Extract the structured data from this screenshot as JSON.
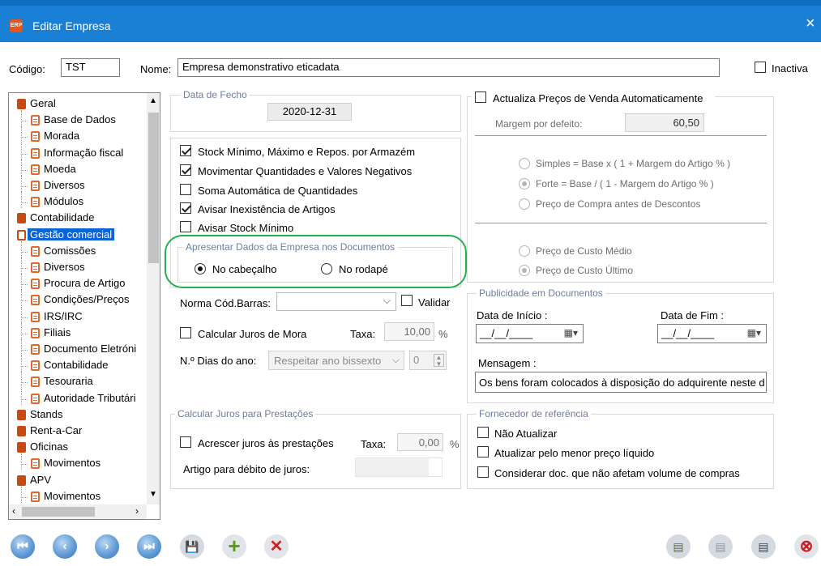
{
  "window": {
    "title": "Editar Empresa",
    "app_icon_text": "ERP",
    "close": "×"
  },
  "header": {
    "codigo_label": "Código:",
    "codigo_value": "TST",
    "nome_label": "Nome:",
    "nome_value": "Empresa demonstrativo eticadata",
    "inactiva_label": "Inactiva"
  },
  "tree": [
    {
      "label": "Geral",
      "level": 0
    },
    {
      "label": "Base de Dados",
      "level": 1
    },
    {
      "label": "Morada",
      "level": 1
    },
    {
      "label": "Informação fiscal",
      "level": 1
    },
    {
      "label": "Moeda",
      "level": 1
    },
    {
      "label": "Diversos",
      "level": 1
    },
    {
      "label": "Módulos",
      "level": 1
    },
    {
      "label": "Contabilidade",
      "level": 0
    },
    {
      "label": "Gestão comercial",
      "level": 0,
      "selected": true
    },
    {
      "label": "Comissões",
      "level": 1
    },
    {
      "label": "Diversos",
      "level": 1
    },
    {
      "label": "Procura de Artigo",
      "level": 1
    },
    {
      "label": "Condições/Preços",
      "level": 1
    },
    {
      "label": "IRS/IRC",
      "level": 1
    },
    {
      "label": "Filiais",
      "level": 1
    },
    {
      "label": "Documento Eletróni",
      "level": 1
    },
    {
      "label": "Contabilidade",
      "level": 1
    },
    {
      "label": "Tesouraria",
      "level": 1
    },
    {
      "label": "Autoridade Tributári",
      "level": 1
    },
    {
      "label": "Stands",
      "level": 0
    },
    {
      "label": "Rent-a-Car",
      "level": 0
    },
    {
      "label": "Oficinas",
      "level": 0
    },
    {
      "label": "Movimentos",
      "level": 1
    },
    {
      "label": "APV",
      "level": 0
    },
    {
      "label": "Movimentos",
      "level": 1
    }
  ],
  "data_fecho": {
    "title": "Data de Fecho",
    "value": "2020-12-31"
  },
  "stock_options": [
    {
      "label": "Stock Mínimo, Máximo e Repos. por Armazém",
      "checked": true
    },
    {
      "label": "Movimentar Quantidades e Valores Negativos",
      "checked": true
    },
    {
      "label": "Soma Automática de Quantidades",
      "checked": false
    },
    {
      "label": "Avisar Inexistência de Artigos",
      "checked": true
    },
    {
      "label": "Avisar Stock Mínimo",
      "checked": false
    }
  ],
  "apresentar": {
    "title": "Apresentar Dados da Empresa nos Documentos",
    "opt1": "No cabeçalho",
    "opt2": "No rodapé",
    "selected": "No cabeçalho"
  },
  "barras": {
    "label": "Norma Cód.Barras:",
    "value": "",
    "validar_label": "Validar"
  },
  "juros_mora": {
    "label": "Calcular Juros de Mora",
    "taxa_label": "Taxa:",
    "taxa_value": "10,00",
    "pct": "%"
  },
  "dias_ano": {
    "label": "N.º Dias do ano:",
    "value": "Respeitar ano bissexto",
    "num": "0"
  },
  "prestacoes": {
    "title": "Calcular Juros para Prestações",
    "acrescer_label": "Acrescer juros às prestações",
    "taxa_label": "Taxa:",
    "taxa_value": "0,00",
    "pct": "%",
    "artigo_label": "Artigo para débito de juros:"
  },
  "precos": {
    "actualiza_label": "Actualiza Preços de Venda Automaticamente",
    "margem_label": "Margem por defeito:",
    "margem_value": "60,50",
    "r1": "Simples = Base x ( 1 + Margem do Artigo % )",
    "r2": "Forte = Base / ( 1 - Margem do Artigo % )",
    "r3": "Preço de Compra antes de Descontos",
    "r4": "Preço de Custo Médio",
    "r5": "Preço de Custo Último"
  },
  "publicidade": {
    "title": "Publicidade em Documentos",
    "inicio_label": "Data de Início :",
    "fim_label": "Data de Fim :",
    "date_placeholder": "__/__/____",
    "mensagem_label": "Mensagem :",
    "mensagem_value": "Os bens foram colocados à disposição do adquirente neste d"
  },
  "fornecedor": {
    "title": "Fornecedor de referência",
    "o1": "Não Atualizar",
    "o2": "Atualizar pelo menor preço líquido",
    "o3": "Considerar doc. que não afetam volume de compras"
  },
  "toolbar": {
    "first": "⏮",
    "prev": "‹",
    "next": "›",
    "last": "⏭",
    "save": "💾",
    "add": "+",
    "delete": "✕",
    "b1": "▤",
    "b2": "▤",
    "b3": "▤",
    "exit": "⊗"
  },
  "colors": {
    "title_bar": "#1a80d6",
    "highlight_ellipse": "#22b14c",
    "tree_selected": "#0a64d6"
  }
}
